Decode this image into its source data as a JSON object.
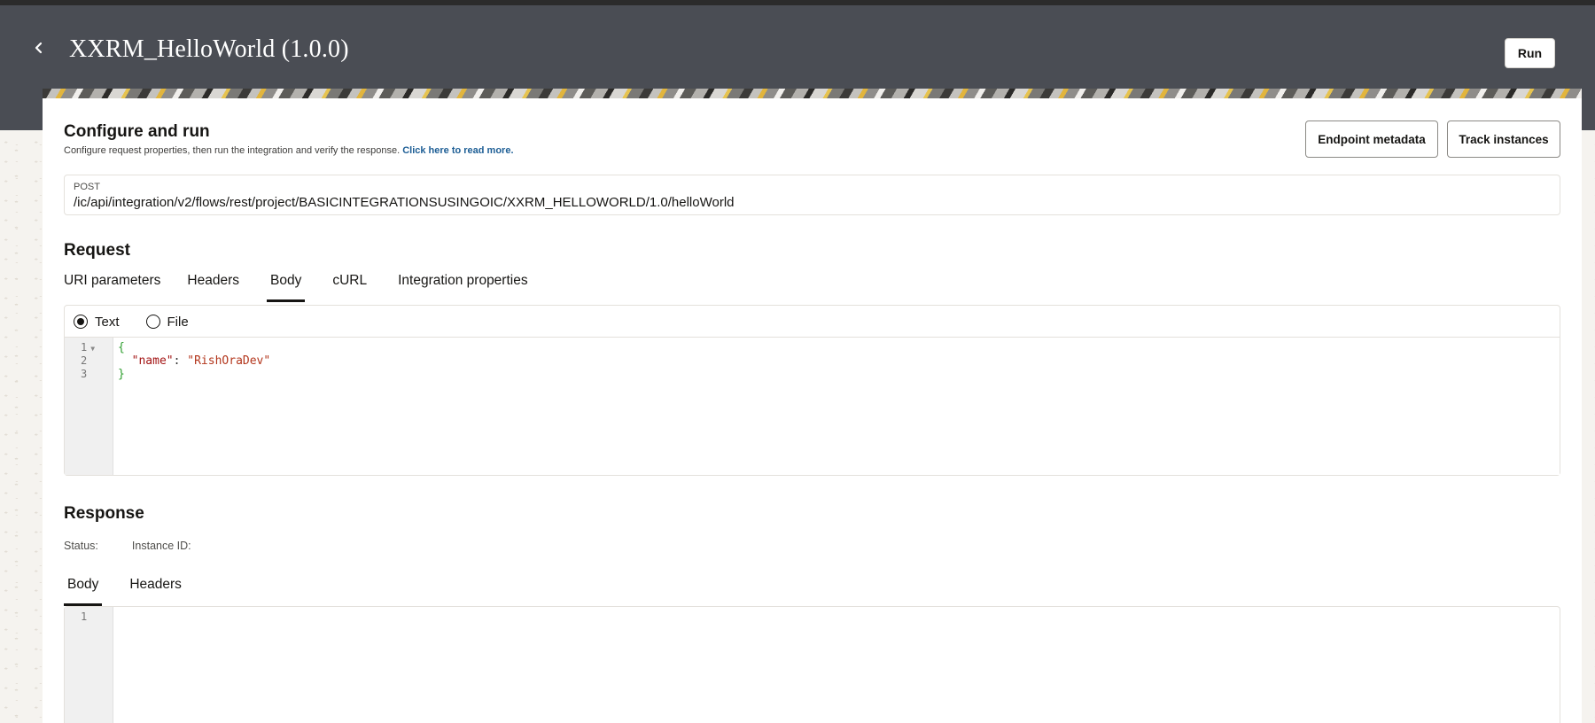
{
  "header": {
    "title": "XXRM_HelloWorld (1.0.0)",
    "back_icon": "chevron-left-icon",
    "run_label": "Run"
  },
  "configure": {
    "heading": "Configure and run",
    "subtitle": "Configure request properties, then run the integration and verify the response.",
    "read_more_link": "Click here to read more.",
    "endpoint_metadata_label": "Endpoint metadata",
    "track_instances_label": "Track instances"
  },
  "endpoint": {
    "method": "POST",
    "uri": "/ic/api/integration/v2/flows/rest/project/BASICINTEGRATIONSUSINGOIC/XXRM_HELLOWORLD/1.0/helloWorld"
  },
  "request": {
    "heading": "Request",
    "tabs": [
      {
        "label": "URI parameters",
        "active": false
      },
      {
        "label": "Headers",
        "active": false
      },
      {
        "label": "Body",
        "active": true
      },
      {
        "label": "cURL",
        "active": false
      },
      {
        "label": "Integration properties",
        "active": false
      }
    ],
    "body_modes": [
      {
        "label": "Text",
        "selected": true
      },
      {
        "label": "File",
        "selected": false
      }
    ],
    "editor": {
      "line_numbers": [
        "1",
        "2",
        "3"
      ],
      "open_brace": "{",
      "key": "\"name\"",
      "colon": ": ",
      "value": "\"RishOraDev\"",
      "close_brace": "}"
    }
  },
  "response": {
    "heading": "Response",
    "status_label": "Status:",
    "instance_id_label": "Instance ID:",
    "tabs": [
      {
        "label": "Body",
        "active": true
      },
      {
        "label": "Headers",
        "active": false
      }
    ],
    "editor": {
      "line_numbers": [
        "1"
      ]
    }
  },
  "colors": {
    "header_bg": "#4a4d54",
    "link": "#1d5e95",
    "json_key": "#a31515",
    "json_brace": "#2e9e2e"
  }
}
